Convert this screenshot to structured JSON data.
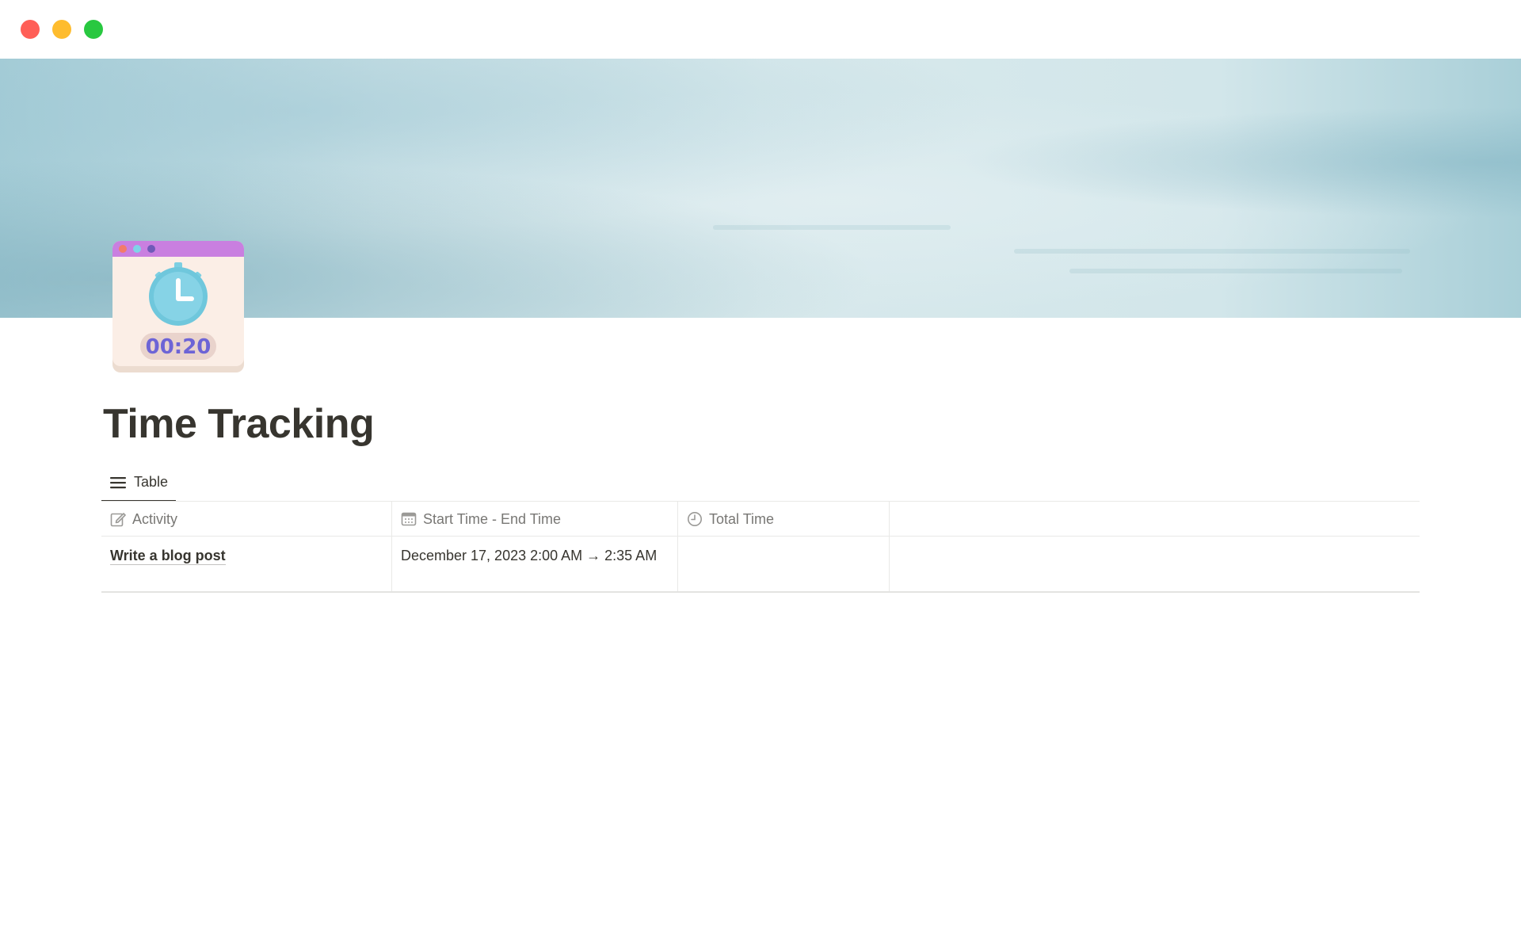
{
  "window": {
    "controls": {
      "close_color": "#ff5f57",
      "minimize_color": "#febc2e",
      "maximize_color": "#28c840"
    }
  },
  "cover": {
    "description_color": "#cfe3e8"
  },
  "page": {
    "icon": {
      "name": "stopwatch-icon",
      "timer_text": "00:20"
    },
    "title": "Time Tracking"
  },
  "views": {
    "tabs": [
      {
        "label": "Table",
        "icon": "list-icon",
        "active": true
      }
    ]
  },
  "table": {
    "columns": [
      {
        "label": "Activity",
        "icon": "edit-icon"
      },
      {
        "label": "Start Time - End Time",
        "icon": "calendar-icon"
      },
      {
        "label": "Total Time",
        "icon": "clock-icon"
      }
    ],
    "rows": [
      {
        "activity": "Write a blog post",
        "time_range": "December 17, 2023 2:00 AM → 2:35 AM",
        "total_time": ""
      }
    ]
  }
}
